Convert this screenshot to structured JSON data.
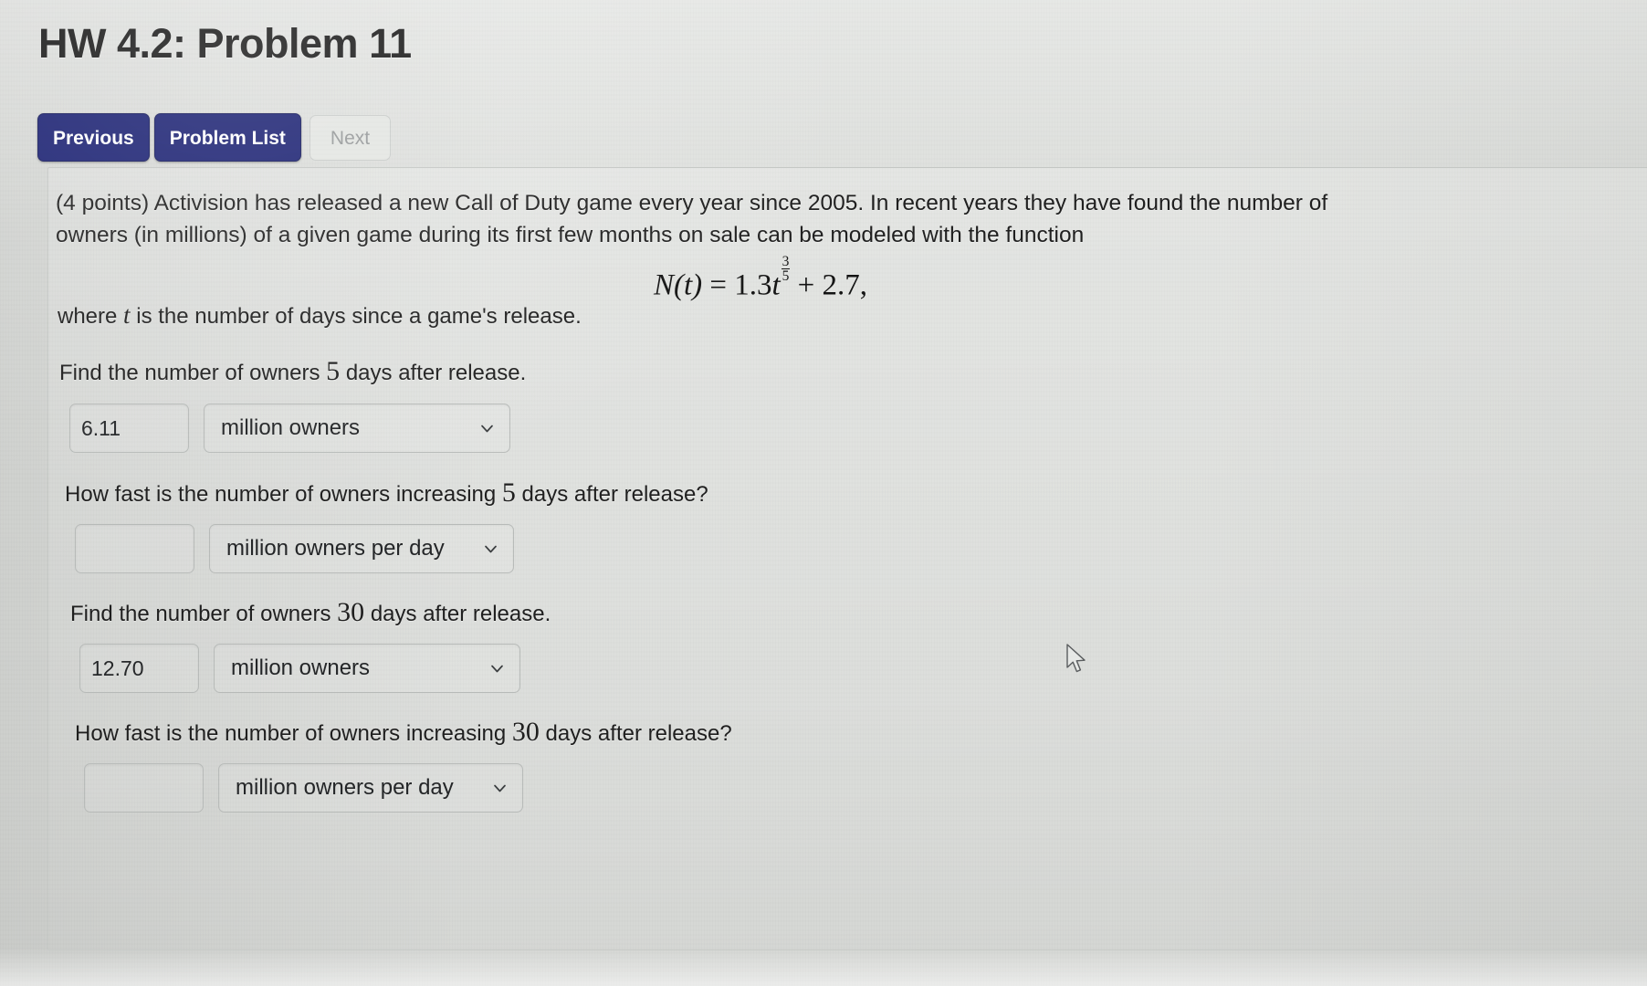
{
  "header": {
    "title": "HW 4.2: Problem 11"
  },
  "nav": {
    "previous_label": "Previous",
    "problem_list_label": "Problem List",
    "next_label": "Next"
  },
  "problem": {
    "points_and_intro": "(4 points) Activision has released a new Call of Duty game every year since 2005. In recent years they have found the number of owners (in millions) of a given game during its first few months on sale can be modeled with the function",
    "formula": {
      "lhs": "N(t)",
      "equals": "=",
      "coefficient": "1.3",
      "variable": "t",
      "exponent_numerator": "3",
      "exponent_denominator": "5",
      "plus": "+",
      "constant": "2.7",
      "trailing_comma": ",",
      "plain_text": "N(t) = 1.3t^(3/5) + 2.7,"
    },
    "where_prefix": "where ",
    "where_variable": "t",
    "where_suffix": " is the number of days since a game's release.",
    "questions": [
      {
        "prefix": "Find the number of owners ",
        "value": "5",
        "suffix": " days after release.",
        "answer_value": "6.11",
        "answer_placeholder": "",
        "unit_selected": "million owners"
      },
      {
        "prefix": "How fast is the number of owners increasing ",
        "value": "5",
        "suffix": " days after release?",
        "answer_value": "",
        "answer_placeholder": "",
        "unit_selected": "million owners per day"
      },
      {
        "prefix": "Find the number of owners ",
        "value": "30",
        "suffix": " days after release.",
        "answer_value": "12.70",
        "answer_placeholder": "",
        "unit_selected": "million owners"
      },
      {
        "prefix": "How fast is the number of owners increasing ",
        "value": "30",
        "suffix": " days after release?",
        "answer_value": "",
        "answer_placeholder": "",
        "unit_selected": "million owners per day"
      }
    ]
  },
  "icons": {
    "chevron_down": "chevron-down-icon",
    "mouse_cursor": "mouse-cursor-icon"
  },
  "colors": {
    "button_primary_bg": "#1d2374",
    "button_primary_text": "#ffffff",
    "button_disabled_text": "#96999a",
    "page_bg": "#dcdedb",
    "text": "#1f1f1f"
  }
}
